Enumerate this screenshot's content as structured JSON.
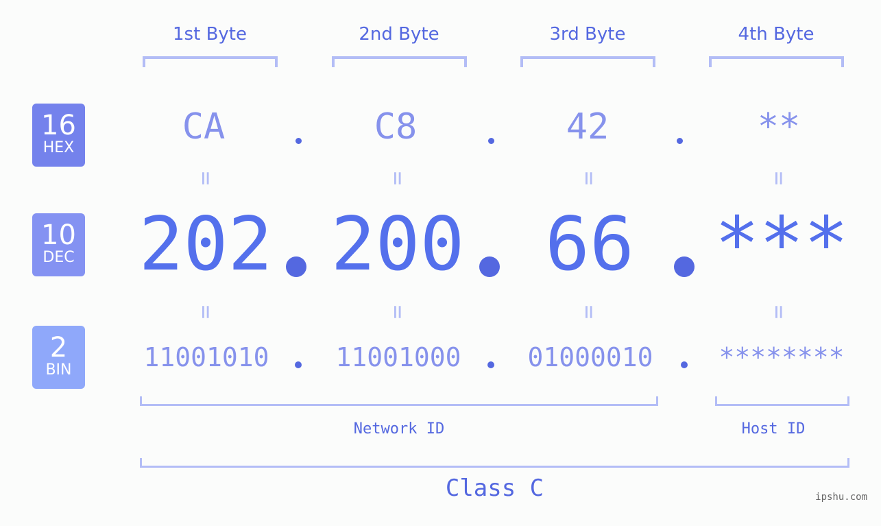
{
  "bases": [
    {
      "number": "16",
      "label": "HEX",
      "color": "#7482ec"
    },
    {
      "number": "10",
      "label": "DEC",
      "color": "#8492f2"
    },
    {
      "number": "2",
      "label": "BIN",
      "color": "#8fa8fa"
    }
  ],
  "bytes": [
    {
      "label": "1st Byte",
      "hex": "CA",
      "dec": "202",
      "bin": "11001010"
    },
    {
      "label": "2nd Byte",
      "hex": "C8",
      "dec": "200",
      "bin": "11001000"
    },
    {
      "label": "3rd Byte",
      "hex": "42",
      "dec": "66",
      "bin": "01000010"
    },
    {
      "label": "4th Byte",
      "hex": "**",
      "dec": "***",
      "bin": "********"
    }
  ],
  "equals_symbol": "=",
  "network_id_label": "Network ID",
  "host_id_label": "Host ID",
  "class_label": "Class C",
  "watermark": "ipshu.com"
}
